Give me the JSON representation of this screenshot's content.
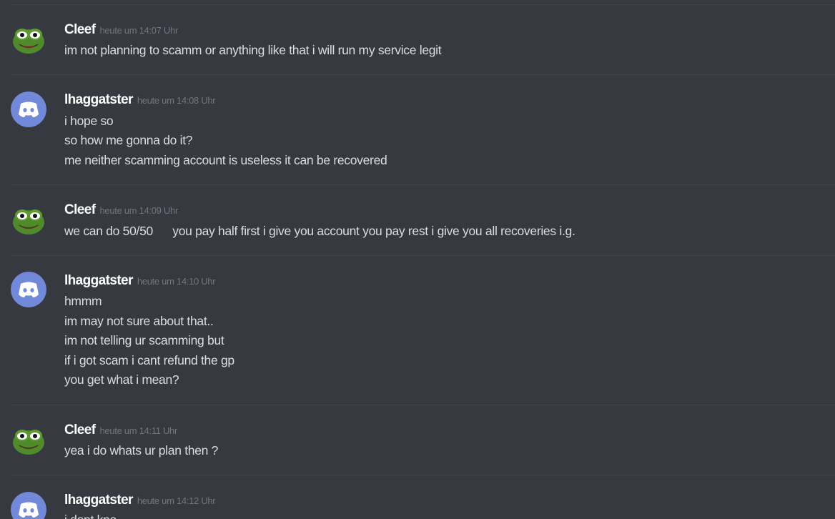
{
  "messages": [
    {
      "author": "Cleef",
      "avatar": "pepe-frog-icon",
      "timestamp": "heute um 14:07 Uhr",
      "lines": [
        "im not planning to scamm or anything like that i will run my service legit"
      ]
    },
    {
      "author": "lhaggatster",
      "avatar": "discord-default-icon",
      "timestamp": "heute um 14:08 Uhr",
      "lines": [
        "i hope so",
        "so how me gonna do it?",
        "me neither scamming account is useless it can be recovered"
      ]
    },
    {
      "author": "Cleef",
      "avatar": "pepe-frog-icon",
      "timestamp": "heute um 14:09 Uhr",
      "lines": [
        "we can do 50/50      you pay half first i give you account you pay rest i give you all recoveries i.g."
      ]
    },
    {
      "author": "lhaggatster",
      "avatar": "discord-default-icon",
      "timestamp": "heute um 14:10 Uhr",
      "lines": [
        "hmmm",
        "im may not sure about that..",
        "im not telling ur scamming but",
        "if i got scam i cant refund the gp",
        "you get what i mean?"
      ]
    },
    {
      "author": "Cleef",
      "avatar": "pepe-frog-icon",
      "timestamp": "heute um 14:11 Uhr",
      "lines": [
        "yea i do whats ur plan then ?"
      ]
    },
    {
      "author": "lhaggatster",
      "avatar": "discord-default-icon",
      "timestamp": "heute um 14:12 Uhr",
      "lines": [
        "i dont kno"
      ]
    }
  ],
  "colors": {
    "background": "#36393f",
    "divider": "#40434a",
    "username": "#ffffff",
    "timestamp": "#72767d",
    "text": "#dcddde",
    "discord_blurple": "#7289da",
    "pepe_green": "#4f8a2b"
  }
}
